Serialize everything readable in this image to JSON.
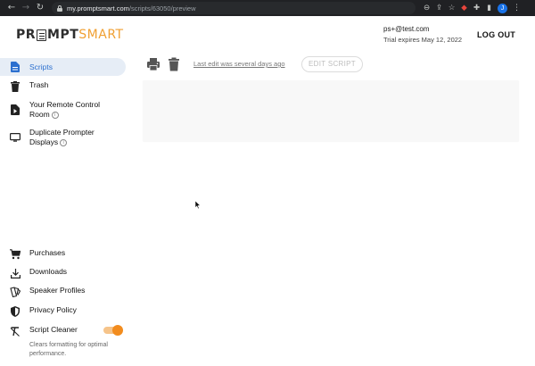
{
  "browser": {
    "url_host": "my.promptsmart.com",
    "url_path": "/scripts/63050/preview",
    "profile_initial": "J"
  },
  "header": {
    "logo_prompt": "PR",
    "logo_prompt_rest": "MPT",
    "logo_smart": "SMART",
    "user_email": "ps+@test.com",
    "trial_text": "Trial expires May 12, 2022",
    "logout_label": "LOG OUT"
  },
  "sidebar": {
    "items": [
      {
        "label": "Scripts",
        "icon": "document-icon",
        "active": true
      },
      {
        "label": "Trash",
        "icon": "trash-icon"
      },
      {
        "label_line1": "Your Remote Control",
        "label_line2": "Room",
        "icon": "remote-play-icon"
      },
      {
        "label_line1": "Duplicate Prompter",
        "label_line2": "Displays",
        "icon": "monitor-icon"
      }
    ],
    "bottom_items": [
      {
        "label": "Purchases",
        "icon": "cart-icon"
      },
      {
        "label": "Downloads",
        "icon": "download-icon"
      },
      {
        "label": "Speaker Profiles",
        "icon": "speaker-profiles-icon"
      },
      {
        "label": "Privacy Policy",
        "icon": "shield-icon"
      },
      {
        "label": "Script Cleaner",
        "icon": "clear-format-icon"
      }
    ],
    "script_cleaner_desc": "Clears formatting for optimal performance.",
    "script_cleaner_on": true
  },
  "toolbar": {
    "last_edit": "Last edit was several days ago",
    "edit_script_label": "EDIT SCRIPT"
  },
  "colors": {
    "accent_blue": "#2b6fcf",
    "brand_orange": "#f0a033",
    "toggle_orange": "#f28c1e",
    "active_bg": "#e6edf6"
  }
}
